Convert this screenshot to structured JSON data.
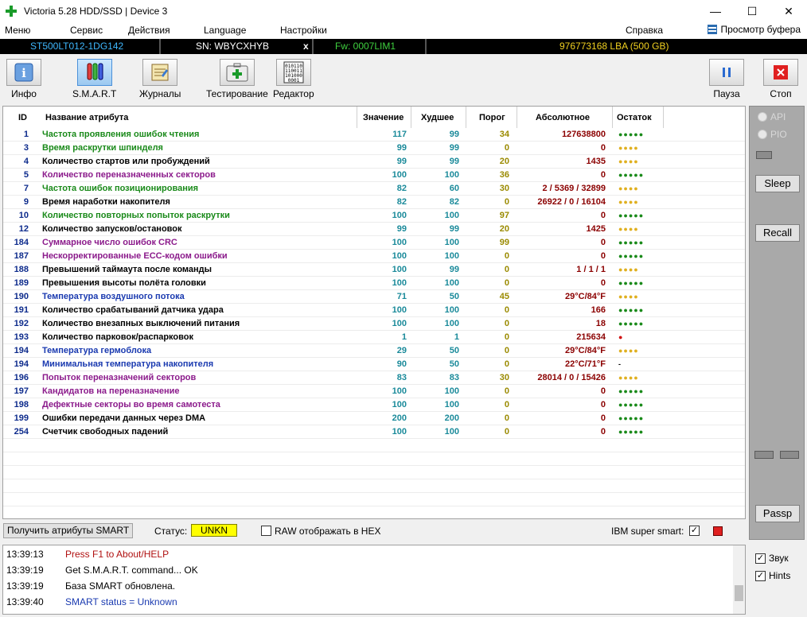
{
  "window": {
    "title": "Victoria 5.28 HDD/SSD | Device 3",
    "minimize": "—",
    "maximize": "☐",
    "close": "✕"
  },
  "menu": {
    "items": [
      "Меню",
      "Сервис",
      "Действия",
      "Language",
      "Настройки",
      "Справка"
    ],
    "buffer_label": "Просмотр буфера"
  },
  "drive": {
    "model": "ST500LT012-1DG142",
    "serial": "SN: WBYCXHYB",
    "close": "x",
    "firmware": "Fw: 0007LIM1",
    "capacity": "976773168 LBA (500 GB)"
  },
  "toolbar": {
    "info": "Инфо",
    "smart": "S.M.A.R.T",
    "logs": "Журналы",
    "testing": "Тестирование",
    "editor": "Редактор",
    "pause": "Пауза",
    "stop": "Стоп"
  },
  "table": {
    "headers": {
      "id": "ID",
      "name": "Название атрибута",
      "value": "Значение",
      "worst": "Худшее",
      "threshold": "Порог",
      "absolute": "Абсолютное",
      "remaining": "Остаток"
    },
    "rows": [
      {
        "id": "1",
        "name": "Частота проявления ошибок чтения",
        "value": "117",
        "worst": "99",
        "thr": "34",
        "abs": "127638800",
        "rem": "●●●●●",
        "name_color": "#1a8a1a",
        "rem_color": "#1a8a1a"
      },
      {
        "id": "3",
        "name": "Время раскрутки шпинделя",
        "value": "99",
        "worst": "99",
        "thr": "0",
        "abs": "0",
        "rem": "●●●●",
        "name_color": "#1a8a1a",
        "rem_color": "#e0b020"
      },
      {
        "id": "4",
        "name": "Количество стартов или пробуждений",
        "value": "99",
        "worst": "99",
        "thr": "20",
        "abs": "1435",
        "rem": "●●●●",
        "name_color": "#000000",
        "rem_color": "#e0b020"
      },
      {
        "id": "5",
        "name": "Количество переназначенных секторов",
        "value": "100",
        "worst": "100",
        "thr": "36",
        "abs": "0",
        "rem": "●●●●●",
        "name_color": "#8b1a8b",
        "rem_color": "#1a8a1a"
      },
      {
        "id": "7",
        "name": "Частота ошибок позиционирования",
        "value": "82",
        "worst": "60",
        "thr": "30",
        "abs": "2 / 5369 / 32899",
        "rem": "●●●●",
        "name_color": "#1a8a1a",
        "rem_color": "#e0b020"
      },
      {
        "id": "9",
        "name": "Время наработки накопителя",
        "value": "82",
        "worst": "82",
        "thr": "0",
        "abs": "26922 / 0 / 16104",
        "rem": "●●●●",
        "name_color": "#000000",
        "rem_color": "#e0b020"
      },
      {
        "id": "10",
        "name": "Количество повторных попыток раскрутки",
        "value": "100",
        "worst": "100",
        "thr": "97",
        "abs": "0",
        "rem": "●●●●●",
        "name_color": "#1a8a1a",
        "rem_color": "#1a8a1a"
      },
      {
        "id": "12",
        "name": "Количество запусков/остановок",
        "value": "99",
        "worst": "99",
        "thr": "20",
        "abs": "1425",
        "rem": "●●●●",
        "name_color": "#000000",
        "rem_color": "#e0b020"
      },
      {
        "id": "184",
        "name": "Суммарное число ошибок CRC",
        "value": "100",
        "worst": "100",
        "thr": "99",
        "abs": "0",
        "rem": "●●●●●",
        "name_color": "#8b1a8b",
        "rem_color": "#1a8a1a"
      },
      {
        "id": "187",
        "name": "Нескорректированные ECC-кодом ошибки",
        "value": "100",
        "worst": "100",
        "thr": "0",
        "abs": "0",
        "rem": "●●●●●",
        "name_color": "#8b1a8b",
        "rem_color": "#1a8a1a"
      },
      {
        "id": "188",
        "name": "Превышений таймаута после команды",
        "value": "100",
        "worst": "99",
        "thr": "0",
        "abs": "1 / 1 / 1",
        "rem": "●●●●",
        "name_color": "#000000",
        "rem_color": "#e0b020"
      },
      {
        "id": "189",
        "name": "Превышения высоты полёта головки",
        "value": "100",
        "worst": "100",
        "thr": "0",
        "abs": "0",
        "rem": "●●●●●",
        "name_color": "#000000",
        "rem_color": "#1a8a1a"
      },
      {
        "id": "190",
        "name": "Температура воздушного потока",
        "value": "71",
        "worst": "50",
        "thr": "45",
        "abs": "29°C/84°F",
        "rem": "●●●●",
        "name_color": "#1a3ab0",
        "rem_color": "#e0b020"
      },
      {
        "id": "191",
        "name": "Количество срабатываний датчика удара",
        "value": "100",
        "worst": "100",
        "thr": "0",
        "abs": "166",
        "rem": "●●●●●",
        "name_color": "#000000",
        "rem_color": "#1a8a1a"
      },
      {
        "id": "192",
        "name": "Количество внезапных выключений питания",
        "value": "100",
        "worst": "100",
        "thr": "0",
        "abs": "18",
        "rem": "●●●●●",
        "name_color": "#000000",
        "rem_color": "#1a8a1a"
      },
      {
        "id": "193",
        "name": "Количество парковок/распарковок",
        "value": "1",
        "worst": "1",
        "thr": "0",
        "abs": "215634",
        "rem": "●",
        "name_color": "#000000",
        "rem_color": "#d01010"
      },
      {
        "id": "194",
        "name": "Температура гермоблока",
        "value": "29",
        "worst": "50",
        "thr": "0",
        "abs": "29°C/84°F",
        "rem": "●●●●",
        "name_color": "#1a3ab0",
        "rem_color": "#e0b020"
      },
      {
        "id": "194",
        "name": "Минимальная температура накопителя",
        "value": "90",
        "worst": "50",
        "thr": "0",
        "abs": "22°C/71°F",
        "rem": "-",
        "name_color": "#1a3ab0",
        "rem_color": "#000000"
      },
      {
        "id": "196",
        "name": "Попыток переназначений секторов",
        "value": "83",
        "worst": "83",
        "thr": "30",
        "abs": "28014 / 0 / 15426",
        "rem": "●●●●",
        "name_color": "#8b1a8b",
        "rem_color": "#e0b020"
      },
      {
        "id": "197",
        "name": "Кандидатов на переназначение",
        "value": "100",
        "worst": "100",
        "thr": "0",
        "abs": "0",
        "rem": "●●●●●",
        "name_color": "#8b1a8b",
        "rem_color": "#1a8a1a"
      },
      {
        "id": "198",
        "name": "Дефектные секторы во время самотеста",
        "value": "100",
        "worst": "100",
        "thr": "0",
        "abs": "0",
        "rem": "●●●●●",
        "name_color": "#8b1a8b",
        "rem_color": "#1a8a1a"
      },
      {
        "id": "199",
        "name": "Ошибки передачи данных через DMA",
        "value": "200",
        "worst": "200",
        "thr": "0",
        "abs": "0",
        "rem": "●●●●●",
        "name_color": "#000000",
        "rem_color": "#1a8a1a"
      },
      {
        "id": "254",
        "name": "Счетчик свободных падений",
        "value": "100",
        "worst": "100",
        "thr": "0",
        "abs": "0",
        "rem": "●●●●●",
        "name_color": "#000000",
        "rem_color": "#1a8a1a"
      }
    ]
  },
  "status": {
    "get_button": "Получить атрибуты SMART",
    "status_label": "Статус:",
    "status_value": "UNKN",
    "raw_hex_label": "RAW отображать в HEX",
    "ibm_label": "IBM super smart:",
    "ibm_checked": "✓"
  },
  "right_panel": {
    "api": "API",
    "pio": "PIO",
    "sleep": "Sleep",
    "recall": "Recall",
    "passp": "Passp"
  },
  "log": [
    {
      "time": "13:39:13",
      "text": "Press F1 to About/HELP",
      "color": "#b01010"
    },
    {
      "time": "13:39:19",
      "text": "Get S.M.A.R.T. command... OK",
      "color": "#000000"
    },
    {
      "time": "13:39:19",
      "text": "База SMART обновлена.",
      "color": "#000000"
    },
    {
      "time": "13:39:40",
      "text": "SMART status = Unknown",
      "color": "#1a3ab0"
    }
  ],
  "side_checks": {
    "sound": "Звук",
    "hints": "Hints",
    "checked": "✓"
  }
}
